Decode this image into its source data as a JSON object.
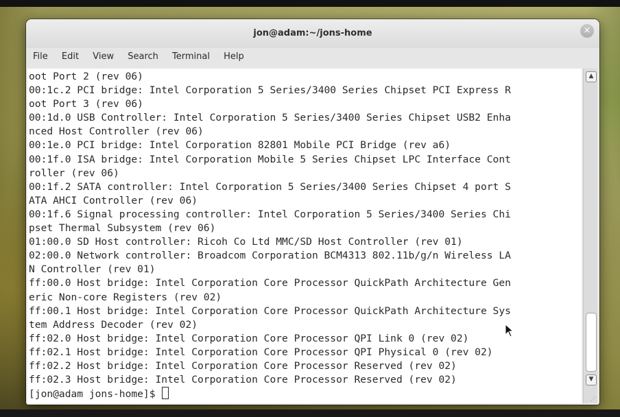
{
  "window": {
    "title": "jon@adam:~/jons-home",
    "close_glyph": "×"
  },
  "menu": {
    "items": [
      "File",
      "Edit",
      "View",
      "Search",
      "Terminal",
      "Help"
    ]
  },
  "terminal": {
    "lines": [
      "oot Port 2 (rev 06)",
      "00:1c.2 PCI bridge: Intel Corporation 5 Series/3400 Series Chipset PCI Express R",
      "oot Port 3 (rev 06)",
      "00:1d.0 USB Controller: Intel Corporation 5 Series/3400 Series Chipset USB2 Enha",
      "nced Host Controller (rev 06)",
      "00:1e.0 PCI bridge: Intel Corporation 82801 Mobile PCI Bridge (rev a6)",
      "00:1f.0 ISA bridge: Intel Corporation Mobile 5 Series Chipset LPC Interface Cont",
      "roller (rev 06)",
      "00:1f.2 SATA controller: Intel Corporation 5 Series/3400 Series Chipset 4 port S",
      "ATA AHCI Controller (rev 06)",
      "00:1f.6 Signal processing controller: Intel Corporation 5 Series/3400 Series Chi",
      "pset Thermal Subsystem (rev 06)",
      "01:00.0 SD Host controller: Ricoh Co Ltd MMC/SD Host Controller (rev 01)",
      "02:00.0 Network controller: Broadcom Corporation BCM4313 802.11b/g/n Wireless LA",
      "N Controller (rev 01)",
      "ff:00.0 Host bridge: Intel Corporation Core Processor QuickPath Architecture Gen",
      "eric Non-core Registers (rev 02)",
      "ff:00.1 Host bridge: Intel Corporation Core Processor QuickPath Architecture Sys",
      "tem Address Decoder (rev 02)",
      "ff:02.0 Host bridge: Intel Corporation Core Processor QPI Link 0 (rev 02)",
      "ff:02.1 Host bridge: Intel Corporation Core Processor QPI Physical 0 (rev 02)",
      "ff:02.2 Host bridge: Intel Corporation Core Processor Reserved (rev 02)",
      "ff:02.3 Host bridge: Intel Corporation Core Processor Reserved (rev 02)"
    ],
    "prompt": "[jon@adam jons-home]$ "
  },
  "scrollbar": {
    "up_glyph": "▲",
    "down_glyph": "▼",
    "position": 0.93
  },
  "icons": {
    "close": "close-icon",
    "scroll_up": "chevron-up-icon",
    "scroll_down": "chevron-down-icon",
    "cursor": "mouse-pointer-icon"
  },
  "colors": {
    "terminal_bg": "#ffffff",
    "terminal_fg": "#2a2a2a",
    "titlebar_bg": "#e4e4e4"
  }
}
